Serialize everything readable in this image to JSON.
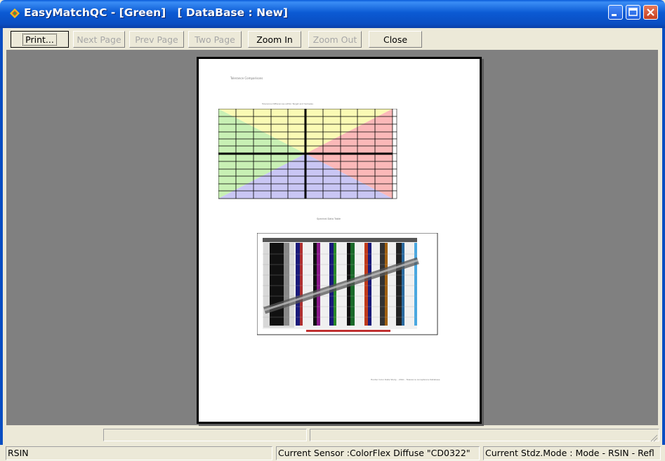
{
  "window": {
    "title": "EasyMatchQC - [Green]   [ DataBase : New]"
  },
  "toolbar": {
    "buttons": [
      {
        "label": "Print...",
        "enabled": true
      },
      {
        "label": "Next Page",
        "enabled": false
      },
      {
        "label": "Prev Page",
        "enabled": false
      },
      {
        "label": "Two Page",
        "enabled": false
      },
      {
        "label": "Zoom In",
        "enabled": true
      },
      {
        "label": "Zoom Out",
        "enabled": false
      },
      {
        "label": "Close",
        "enabled": true
      }
    ]
  },
  "preview_page": {
    "header_text": "Tolerance Comparisons",
    "plot_caption": "Tolerance Differences within Target and Samples",
    "table_title": "Spectral Data Table",
    "footer_text": "Hunter Color Data Study - 2010 - Tolerance Acceptance Database",
    "quadrant_colors": {
      "top_left": "#c8f0b4",
      "top_right": "#fbb8b8",
      "bottom_left": "#c9c6f4",
      "bottom_right": "#c9c6f4",
      "top_mid": "#fafab4"
    }
  },
  "status": {
    "mode_short": "RSIN",
    "sensor": "Current Sensor :ColorFlex Diffuse \"CD0322\"",
    "stdz_mode": "Current Stdz.Mode :  Mode - RSIN - Refl"
  }
}
